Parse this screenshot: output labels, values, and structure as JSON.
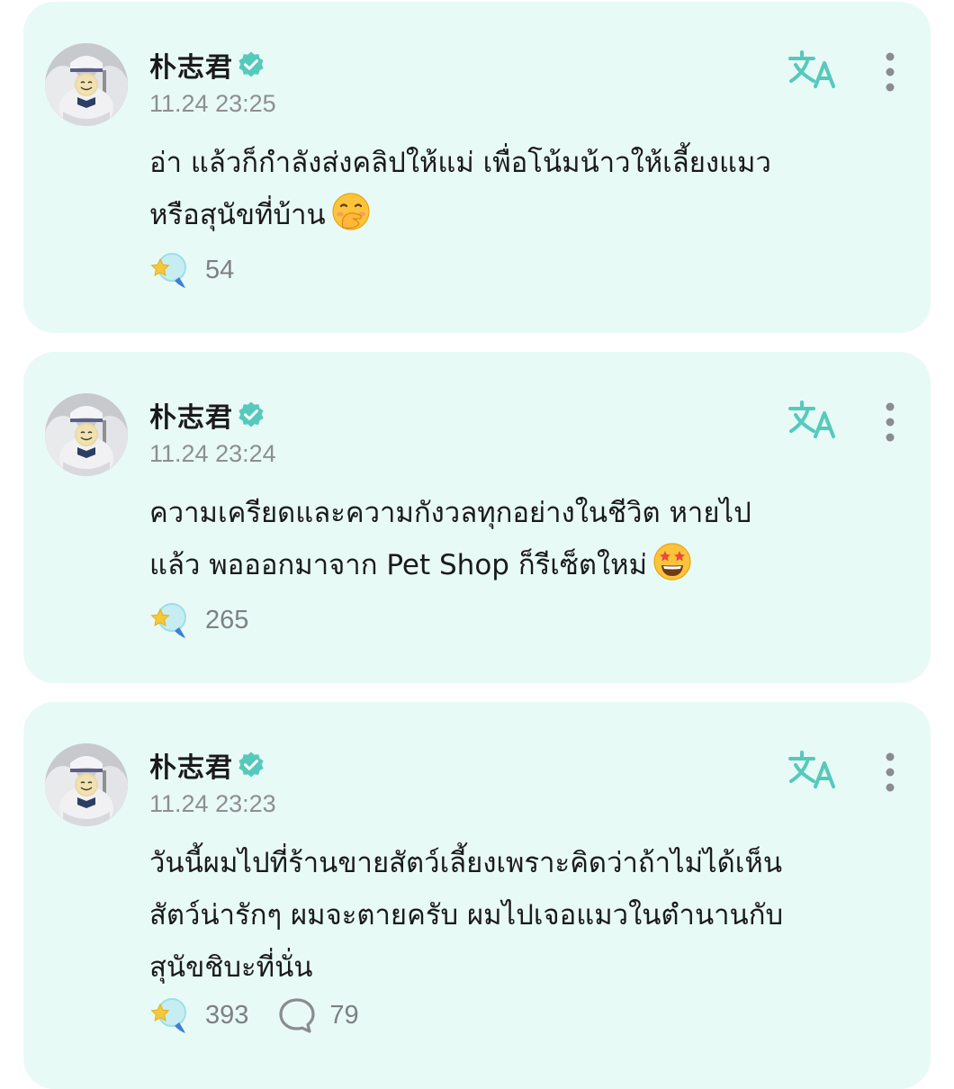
{
  "posts": [
    {
      "author": "朴志君",
      "time": "11.24 23:25",
      "lines": [
        "อ่า แล้วก็กำลังส่งคลิปให้แม่ เพื่อโน้มน้าวให้เลี้ยงแมว",
        "หรือสุนัขที่บ้าน"
      ],
      "emoji": "hand-over-mouth-emoji",
      "likes": "54"
    },
    {
      "author": "朴志君",
      "time": "11.24 23:24",
      "lines": [
        "ความเครียดและความกังวลทุกอย่างในชีวิต หายไป",
        "แล้ว พอออกมาจาก Pet Shop ก็รีเซ็ตใหม่"
      ],
      "emoji": "star-struck-emoji",
      "likes": "265"
    },
    {
      "author": "朴志君",
      "time": "11.24 23:23",
      "lines": [
        "วันนี้ผมไปที่ร้านขายสัตว์เลี้ยงเพราะคิดว่าถ้าไม่ได้เห็น",
        "สัตว์น่ารักๆ ผมจะตายครับ ผมไปเจอแมวในตำนานกับ",
        "สุนัขชิบะที่นั่น"
      ],
      "likes": "393",
      "comments": "79"
    }
  ],
  "icons": {
    "verified": "verified-badge-icon",
    "translate": "translate-icon",
    "more": "more-vertical-icon",
    "like": "star-bubble-like-icon",
    "comment": "comment-bubble-icon"
  },
  "colors": {
    "card_background": "#e8faf6",
    "accent": "#5ecdc0",
    "text": "#1a1a1a",
    "muted": "#8d8f91"
  }
}
